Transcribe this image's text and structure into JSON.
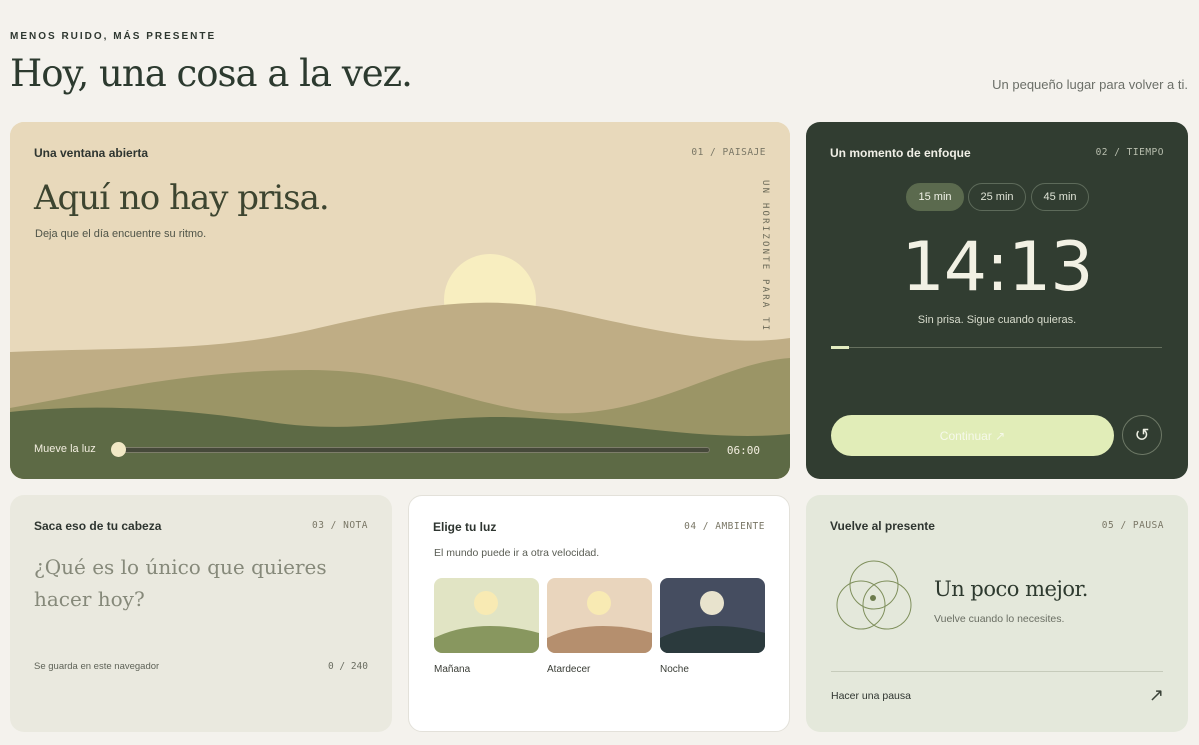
{
  "header": {
    "eyebrow": "MENOS RUIDO, MÁS PRESENTE",
    "title": "Hoy, una cosa a la vez.",
    "tagline": "Un pequeño lugar para volver a ti."
  },
  "landscape": {
    "title": "Una ventana abierta",
    "tag": "01 / PAISAJE",
    "headline": "Aquí no hay prisa.",
    "subtitle": "Deja que el día encuentre su ritmo.",
    "vertical_text": "UN HORIZONTE PARA TI",
    "slider_label": "Mueve la luz",
    "time": "06:00",
    "slider_value": 0.0
  },
  "focus": {
    "title": "Un momento de enfoque",
    "tag": "02 / TIEMPO",
    "durations": [
      "15 min",
      "25 min",
      "45 min"
    ],
    "selected_duration": "15 min",
    "clock": "14:13",
    "status": "Sin prisa. Sigue cuando quieras.",
    "progress": 0.05,
    "continue_label": "Continuar ↗",
    "reset_icon": "↺"
  },
  "note": {
    "title": "Saca eso de tu cabeza",
    "tag": "03 / NOTA",
    "placeholder": "¿Qué es lo único que quieres hacer hoy?",
    "footer": "Se guarda en este navegador",
    "count": "0 / 240"
  },
  "ambient": {
    "title": "Elige tu luz",
    "tag": "04 / AMBIENTE",
    "description": "El mundo puede ir a otra velocidad.",
    "options": [
      {
        "label": "Mañana",
        "sky": "#e1e4c4",
        "ground": "#88975f",
        "sun": "#f8eab3"
      },
      {
        "label": "Atardecer",
        "sky": "#e9d5bd",
        "ground": "#b58f6e",
        "sun": "#f8eab3"
      },
      {
        "label": "Noche",
        "sky": "#454d60",
        "ground": "#2b3a3d",
        "sun": "#e8e3cd"
      }
    ]
  },
  "pause": {
    "title": "Vuelve al presente",
    "tag": "05 / PAUSA",
    "message": "Un poco mejor.",
    "message_sub": "Vuelve cuando lo necesites.",
    "action": "Hacer una pausa",
    "action_icon": "↗"
  },
  "colors": {
    "background": "#f4f2ed",
    "landscape_bg": "#e8d9bb",
    "focus_bg": "#313d31",
    "accent": "#e1edb8"
  }
}
